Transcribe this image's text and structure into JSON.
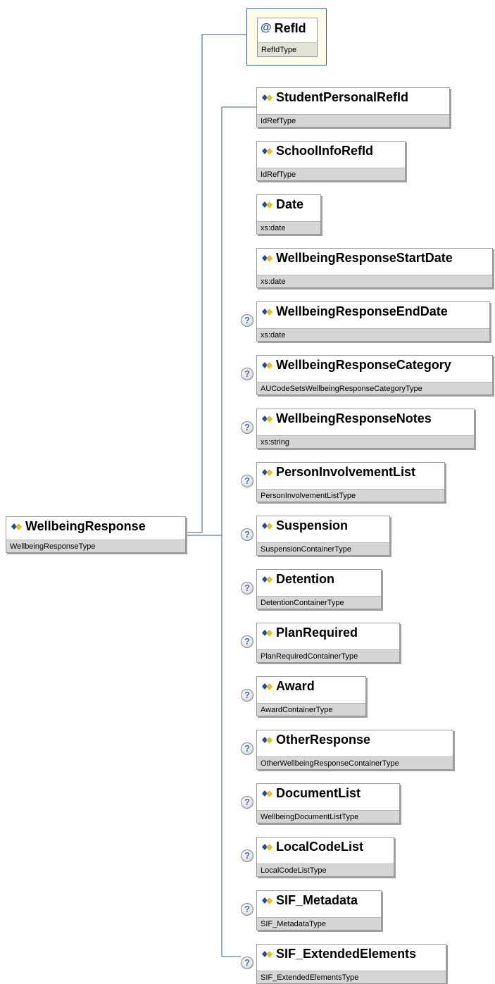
{
  "root": {
    "name": "WellbeingResponse",
    "type": "WellbeingResponseType",
    "icon": "element-icon"
  },
  "attribute": {
    "symbol": "@",
    "name": "RefId",
    "type": "RefIdType"
  },
  "elements": [
    {
      "name": "StudentPersonalRefId",
      "type": "IdRefType",
      "optional": false
    },
    {
      "name": "SchoolInfoRefId",
      "type": "IdRefType",
      "optional": false
    },
    {
      "name": "Date",
      "type": "xs:date",
      "optional": false
    },
    {
      "name": "WellbeingResponseStartDate",
      "type": "xs:date",
      "optional": false
    },
    {
      "name": "WellbeingResponseEndDate",
      "type": "xs:date",
      "optional": true
    },
    {
      "name": "WellbeingResponseCategory",
      "type": "AUCodeSetsWellbeingResponseCategoryType",
      "optional": true
    },
    {
      "name": "WellbeingResponseNotes",
      "type": "xs:string",
      "optional": true
    },
    {
      "name": "PersonInvolvementList",
      "type": "PersonInvolvementListType",
      "optional": true
    },
    {
      "name": "Suspension",
      "type": "SuspensionContainerType",
      "optional": true
    },
    {
      "name": "Detention",
      "type": "DetentionContainerType",
      "optional": true
    },
    {
      "name": "PlanRequired",
      "type": "PlanRequiredContainerType",
      "optional": true
    },
    {
      "name": "Award",
      "type": "AwardContainerType",
      "optional": true
    },
    {
      "name": "OtherResponse",
      "type": "OtherWellbeingResponseContainerType",
      "optional": true
    },
    {
      "name": "DocumentList",
      "type": "WellbeingDocumentListType",
      "optional": true
    },
    {
      "name": "LocalCodeList",
      "type": "LocalCodeListType",
      "optional": true
    },
    {
      "name": "SIF_Metadata",
      "type": "SIF_MetadataType",
      "optional": true
    },
    {
      "name": "SIF_ExtendedElements",
      "type": "SIF_ExtendedElementsType",
      "optional": true
    }
  ],
  "optional_marker": "?",
  "colors": {
    "connector": "#3a5e80",
    "icon_blue": "#1d4fa0",
    "icon_yellow": "#f2c200"
  }
}
